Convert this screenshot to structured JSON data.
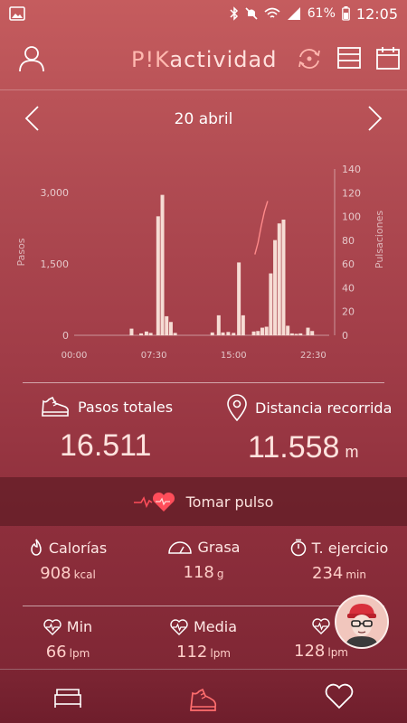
{
  "status_bar": {
    "battery": "61%",
    "time": "12:05",
    "icons": [
      "image-icon",
      "bluetooth-icon",
      "mute-icon",
      "wifi-icon",
      "signal-icon",
      "battery-icon"
    ]
  },
  "app_bar": {
    "logo_prefix": "P!K",
    "logo_suffix": "actividad",
    "icons": [
      "user-icon",
      "sync-icon",
      "list-icon",
      "calendar-icon"
    ]
  },
  "date_nav": {
    "date": "20 abril",
    "prev_icon": "chevron-left-icon",
    "next_icon": "chevron-right-icon"
  },
  "chart_data": {
    "type": "bar",
    "ylabel": "Pasos",
    "y2label": "Pulsaciones",
    "ylim": [
      0,
      3000
    ],
    "y_ticks": [
      "0",
      "1,500",
      "3,000"
    ],
    "y2lim": [
      0,
      140
    ],
    "y2_ticks": [
      "0",
      "20",
      "40",
      "60",
      "80",
      "100",
      "120",
      "140"
    ],
    "x_ticks": [
      "00:00",
      "07:30",
      "15:00",
      "22:30"
    ],
    "xlim_hours": [
      0,
      24
    ],
    "series": [
      {
        "type": "bar",
        "axis": "left",
        "points": [
          {
            "h": 5.4,
            "v": 140
          },
          {
            "h": 6.3,
            "v": 40
          },
          {
            "h": 6.8,
            "v": 80
          },
          {
            "h": 7.2,
            "v": 50
          },
          {
            "h": 7.9,
            "v": 2500
          },
          {
            "h": 8.3,
            "v": 2950
          },
          {
            "h": 8.7,
            "v": 400
          },
          {
            "h": 9.1,
            "v": 280
          },
          {
            "h": 9.5,
            "v": 50
          },
          {
            "h": 13.0,
            "v": 60
          },
          {
            "h": 13.6,
            "v": 420
          },
          {
            "h": 14.0,
            "v": 60
          },
          {
            "h": 14.5,
            "v": 70
          },
          {
            "h": 15.0,
            "v": 50
          },
          {
            "h": 15.5,
            "v": 1530
          },
          {
            "h": 15.9,
            "v": 420
          },
          {
            "h": 16.9,
            "v": 80
          },
          {
            "h": 17.3,
            "v": 90
          },
          {
            "h": 17.7,
            "v": 160
          },
          {
            "h": 18.1,
            "v": 180
          },
          {
            "h": 18.5,
            "v": 1300
          },
          {
            "h": 18.9,
            "v": 2000
          },
          {
            "h": 19.3,
            "v": 2350
          },
          {
            "h": 19.7,
            "v": 2430
          },
          {
            "h": 20.1,
            "v": 200
          },
          {
            "h": 20.5,
            "v": 40
          },
          {
            "h": 20.9,
            "v": 30
          },
          {
            "h": 21.3,
            "v": 40
          },
          {
            "h": 22.0,
            "v": 160
          },
          {
            "h": 22.4,
            "v": 90
          }
        ]
      },
      {
        "type": "line",
        "axis": "right",
        "points": [
          {
            "h": 17.0,
            "v": 68
          },
          {
            "h": 17.3,
            "v": 78
          },
          {
            "h": 17.6,
            "v": 92
          },
          {
            "h": 17.9,
            "v": 104
          },
          {
            "h": 18.2,
            "v": 113
          }
        ]
      }
    ]
  },
  "totals": {
    "steps_label": "Pasos totales",
    "steps_value": "16.511",
    "distance_label": "Distancia recorrida",
    "distance_value": "11.558",
    "distance_unit": "m"
  },
  "pulse_action": {
    "label": "Tomar pulso"
  },
  "stats_row1": {
    "calories_label": "Calorías",
    "calories_value": "908",
    "calories_unit": "kcal",
    "fat_label": "Grasa",
    "fat_value": "118",
    "fat_unit": "g",
    "exercise_label": "T. ejercicio",
    "exercise_value": "234",
    "exercise_unit": "min"
  },
  "stats_row2": {
    "min_label": "Min",
    "min_value": "66",
    "min_unit": "lpm",
    "avg_label": "Media",
    "avg_value": "112",
    "avg_unit": "lpm",
    "max_value": "128",
    "max_unit": "lpm"
  },
  "bottom_nav": {
    "icons": [
      "sleep-bed-icon",
      "activity-shoe-icon",
      "heart-icon"
    ]
  },
  "colors": {
    "bar": "#f6dcd4",
    "line": "#ff8a8a",
    "accent": "#ff4d5a"
  }
}
